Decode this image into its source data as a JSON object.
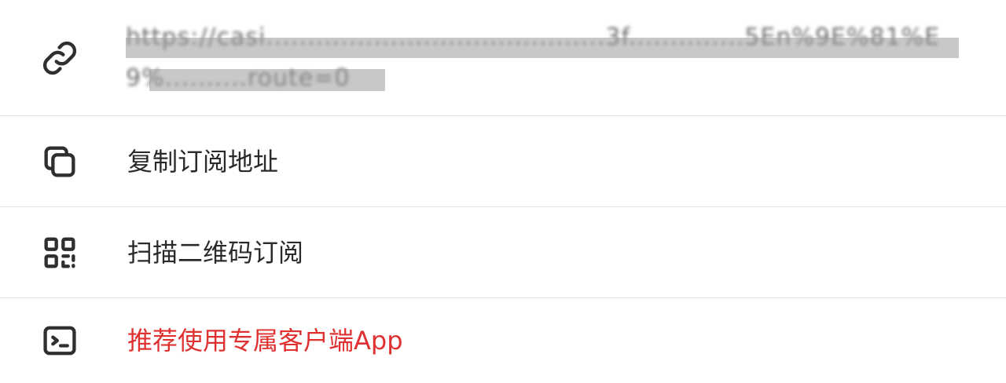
{
  "menu": {
    "url": {
      "icon": "link-icon",
      "text": "https://casi.........................................3f..............5En%9E%81%E9%..........route=0"
    },
    "items": [
      {
        "icon": "copy-icon",
        "label": "复制订阅地址",
        "color": "#2a2a2a"
      },
      {
        "icon": "qr-code-icon",
        "label": "扫描二维码订阅",
        "color": "#2a2a2a"
      },
      {
        "icon": "terminal-icon",
        "label": "推荐使用专属客户端App",
        "color": "#e03131"
      }
    ]
  }
}
